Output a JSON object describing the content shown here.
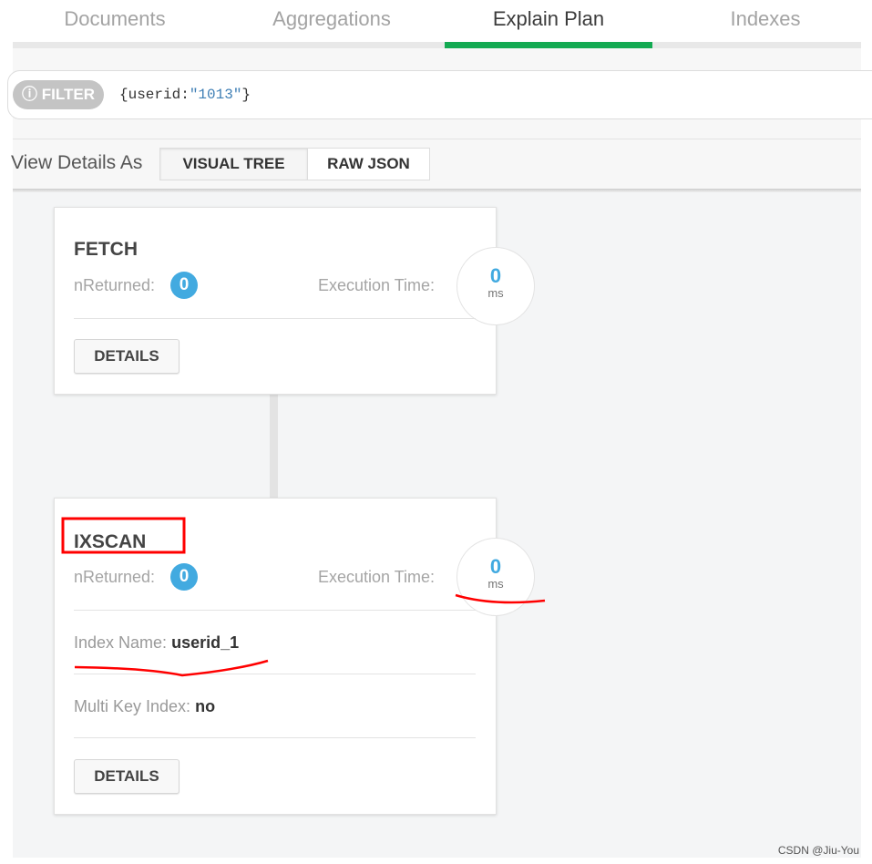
{
  "tabs": [
    {
      "label": "Documents"
    },
    {
      "label": "Aggregations"
    },
    {
      "label": "Explain Plan",
      "active": true
    },
    {
      "label": "Indexes"
    }
  ],
  "filter": {
    "label": "FILTER",
    "icon": "info-icon",
    "prefix": "{userid:",
    "value": "\"1013\"",
    "suffix": "}"
  },
  "view": {
    "label": "View Details As",
    "options": [
      "VISUAL TREE",
      "RAW JSON"
    ],
    "selected": "VISUAL TREE"
  },
  "stages": [
    {
      "title": "FETCH",
      "nReturned_label": "nReturned:",
      "nReturned": "0",
      "exec_label": "Execution Time:",
      "exec_value": "0",
      "exec_unit": "ms",
      "details": "DETAILS"
    },
    {
      "title": "IXSCAN",
      "nReturned_label": "nReturned:",
      "nReturned": "0",
      "exec_label": "Execution Time:",
      "exec_value": "0",
      "exec_unit": "ms",
      "index_label": "Index Name:",
      "index_value": "userid_1",
      "multi_label": "Multi Key Index:",
      "multi_value": "no",
      "details": "DETAILS"
    }
  ],
  "colors": {
    "accent": "#13aa52",
    "badge": "#42aae0",
    "annotation": "#ff0000"
  },
  "credit": "CSDN @Jiu-You"
}
